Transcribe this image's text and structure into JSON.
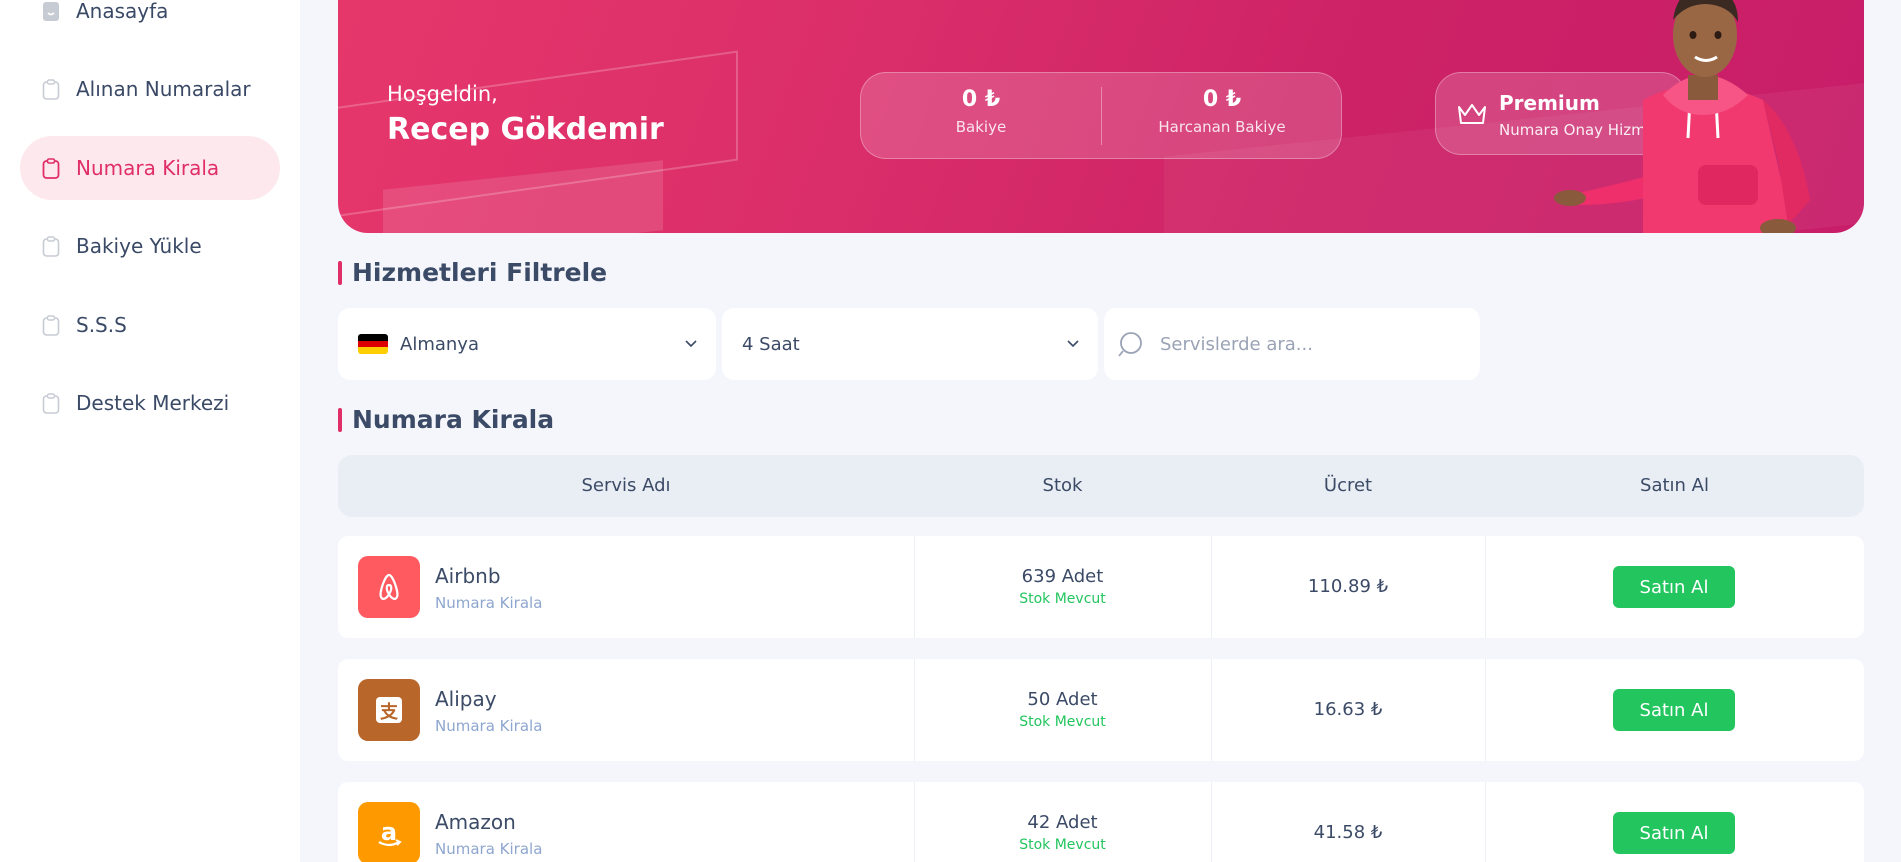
{
  "sidebar": {
    "items": [
      {
        "label": "Anasayfa"
      },
      {
        "label": "Alınan Numaralar"
      },
      {
        "label": "Numara Kirala",
        "active": true
      },
      {
        "label": "Bakiye Yükle"
      },
      {
        "label": "S.S.S"
      },
      {
        "label": "Destek Merkezi"
      }
    ]
  },
  "hero": {
    "greeting": "Hoşgeldin,",
    "name": "Recep Gökdemir",
    "balance_value": "0 ₺",
    "balance_label": "Bakiye",
    "spent_value": "0 ₺",
    "spent_label": "Harcanan Bakiye",
    "premium_title": "Premium",
    "premium_sub": "Numara Onay Hizmetleri"
  },
  "filters": {
    "title": "Hizmetleri Filtrele",
    "country": "Almanya",
    "duration": "4 Saat",
    "search_placeholder": "Servislerde ara..."
  },
  "table": {
    "title": "Numara Kirala",
    "headers": {
      "service": "Servis Adı",
      "stock": "Stok",
      "price": "Ücret",
      "buy": "Satın Al"
    },
    "rows": [
      {
        "name": "Airbnb",
        "sub": "Numara Kirala",
        "stock": "639 Adet",
        "stock_status": "Stok Mevcut",
        "price": "110.89 ₺",
        "button": "Satın Al",
        "icon": "airbnb-icon",
        "color": "#ff5a5f"
      },
      {
        "name": "Alipay",
        "sub": "Numara Kirala",
        "stock": "50 Adet",
        "stock_status": "Stok Mevcut",
        "price": "16.63 ₺",
        "button": "Satın Al",
        "icon": "alipay-icon",
        "color": "#b8662a"
      },
      {
        "name": "Amazon",
        "sub": "Numara Kirala",
        "stock": "42 Adet",
        "stock_status": "Stok Mevcut",
        "price": "41.58 ₺",
        "button": "Satın Al",
        "icon": "amazon-icon",
        "color": "#ff9900"
      }
    ]
  },
  "colors": {
    "accent": "#e02e66",
    "success": "#22c55e"
  }
}
